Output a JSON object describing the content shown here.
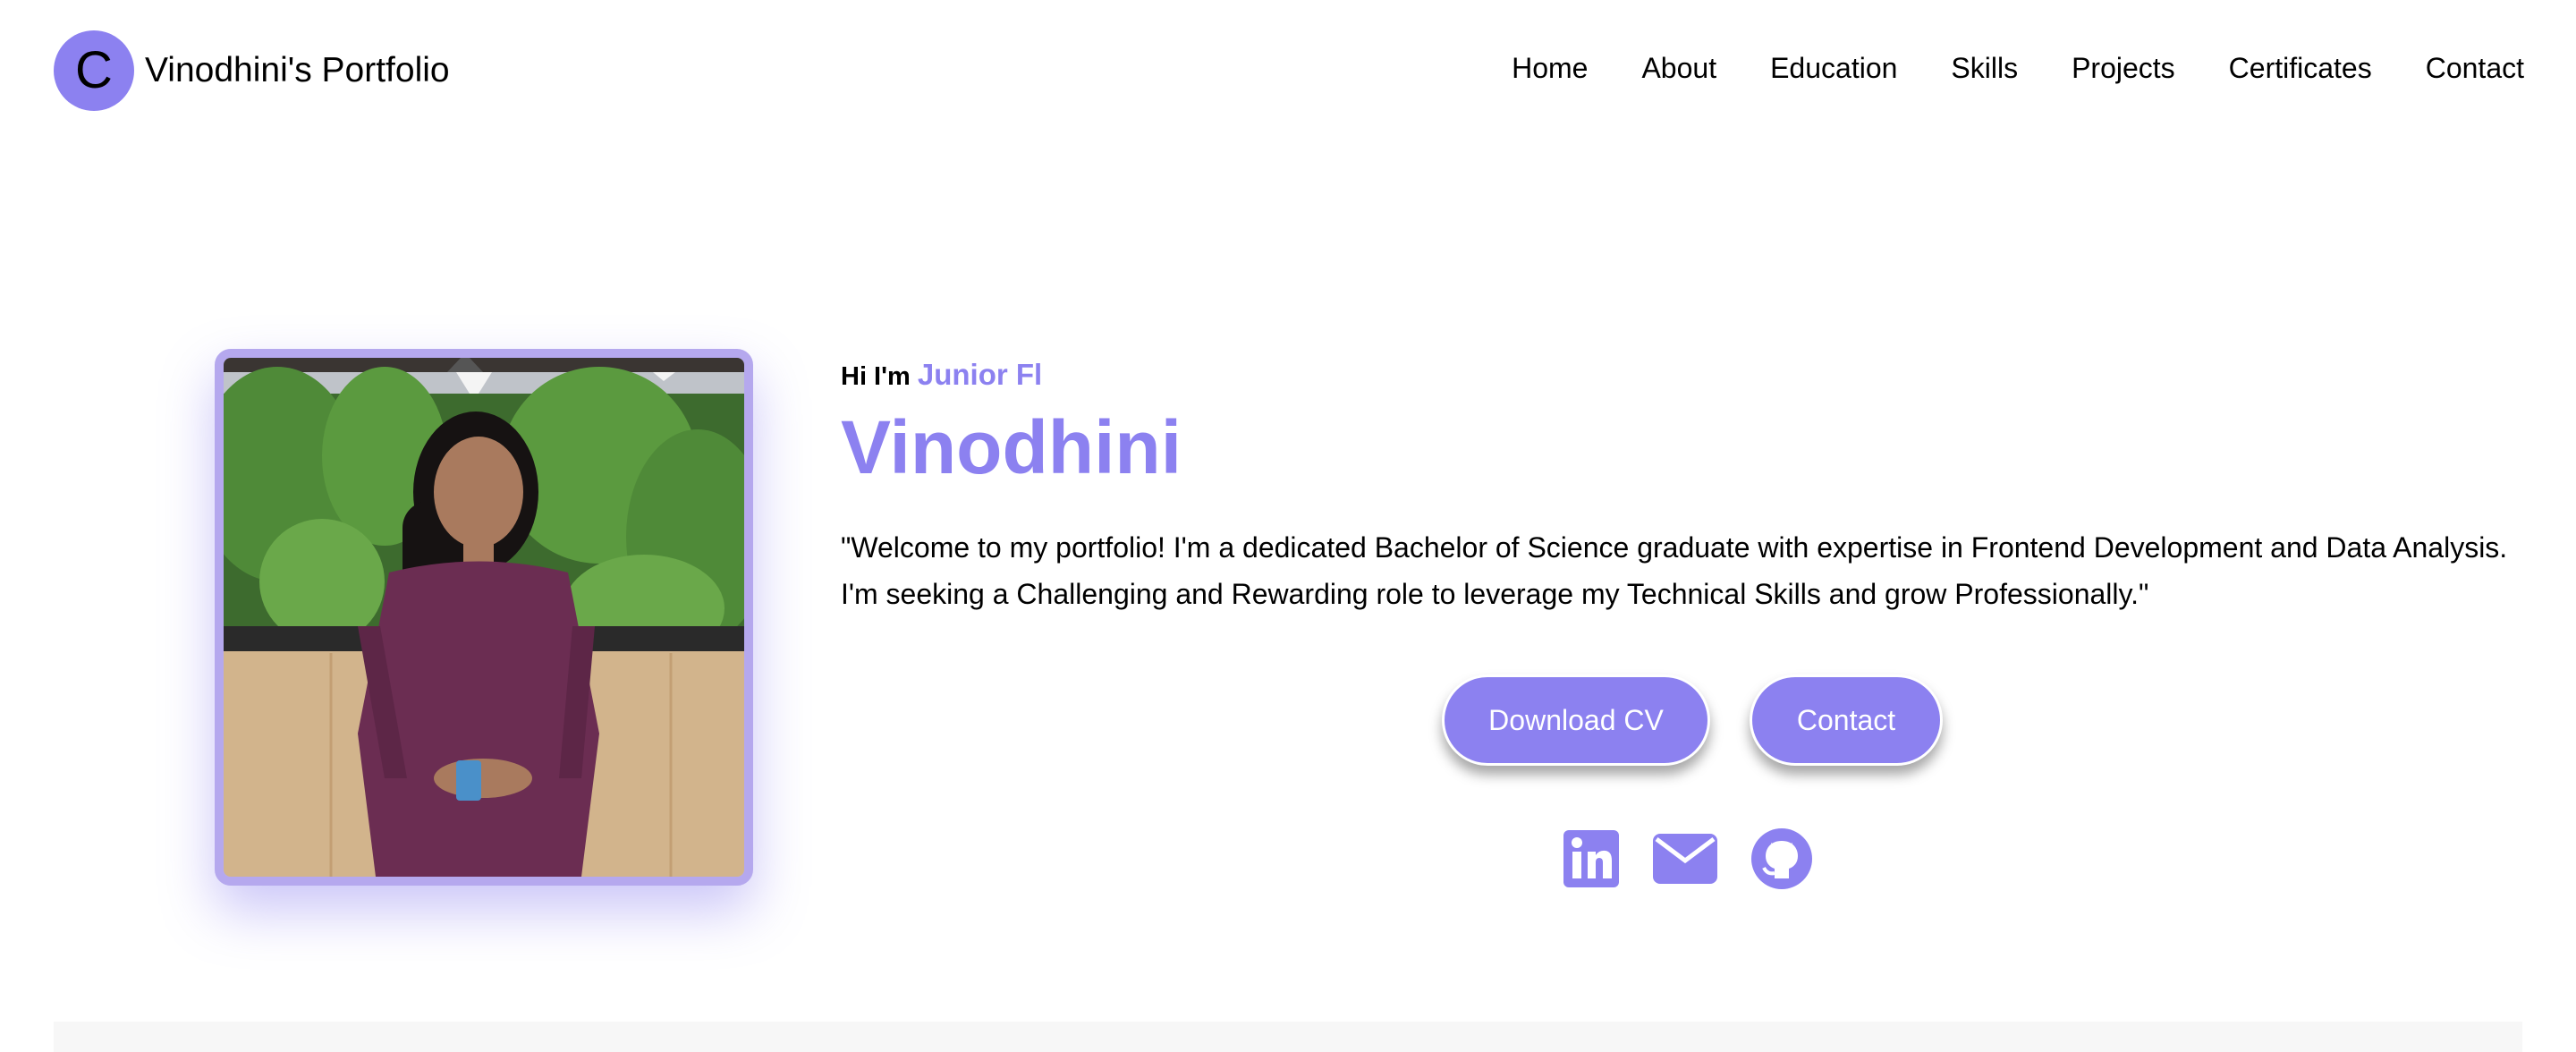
{
  "header": {
    "logo_letter": "C",
    "site_title": "Vinodhini's Portfolio",
    "nav": [
      {
        "label": "Home"
      },
      {
        "label": "About"
      },
      {
        "label": "Education"
      },
      {
        "label": "Skills"
      },
      {
        "label": "Projects"
      },
      {
        "label": "Certificates"
      },
      {
        "label": "Contact"
      }
    ]
  },
  "hero": {
    "greeting": "Hi I'm",
    "role_typed": "Junior Fl",
    "name": "Vinodhini",
    "bio": "\"Welcome to my portfolio! I'm a dedicated Bachelor of Science graduate with expertise in Frontend Development and Data Analysis. I'm seeking a Challenging and Rewarding role to leverage my Technical Skills and grow Professionally.\"",
    "buttons": {
      "download_cv": "Download CV",
      "contact": "Contact"
    },
    "social_icons": [
      "linkedin-icon",
      "email-icon",
      "github-icon"
    ]
  },
  "colors": {
    "accent": "#8c81f0",
    "photo_border": "#b5a8ee",
    "text": "#000000",
    "button_text": "#ffffff"
  }
}
